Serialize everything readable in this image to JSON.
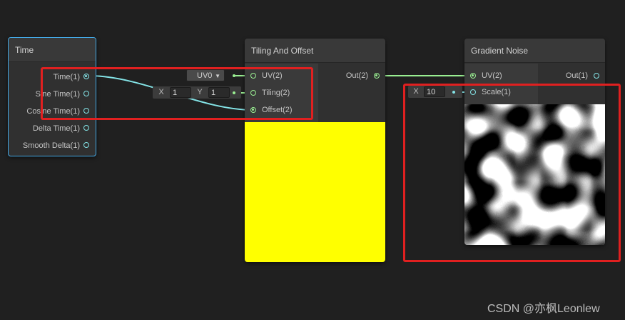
{
  "time_node": {
    "title": "Time",
    "outputs": [
      "Time(1)",
      "Sine Time(1)",
      "Cosine Time(1)",
      "Delta Time(1)",
      "Smooth Delta(1)"
    ]
  },
  "tiling_node": {
    "title": "Tiling And Offset",
    "inputs": [
      "UV(2)",
      "Tiling(2)",
      "Offset(2)"
    ],
    "output": "Out(2)",
    "uv_dropdown": "UV0",
    "tiling_x_label": "X",
    "tiling_x_value": "1",
    "tiling_y_label": "Y",
    "tiling_y_value": "1",
    "preview_color": "#ffff00"
  },
  "noise_node": {
    "title": "Gradient Noise",
    "inputs": [
      "UV(2)",
      "Scale(1)"
    ],
    "output": "Out(1)",
    "scale_x_label": "X",
    "scale_x_value": "10"
  },
  "colors": {
    "float_port": "#84e4e7",
    "vector2_port": "#9aef92",
    "highlight_border": "#e02020",
    "node_selected_border": "#44a9e6"
  },
  "watermark": "CSDN @亦枫Leonlew"
}
